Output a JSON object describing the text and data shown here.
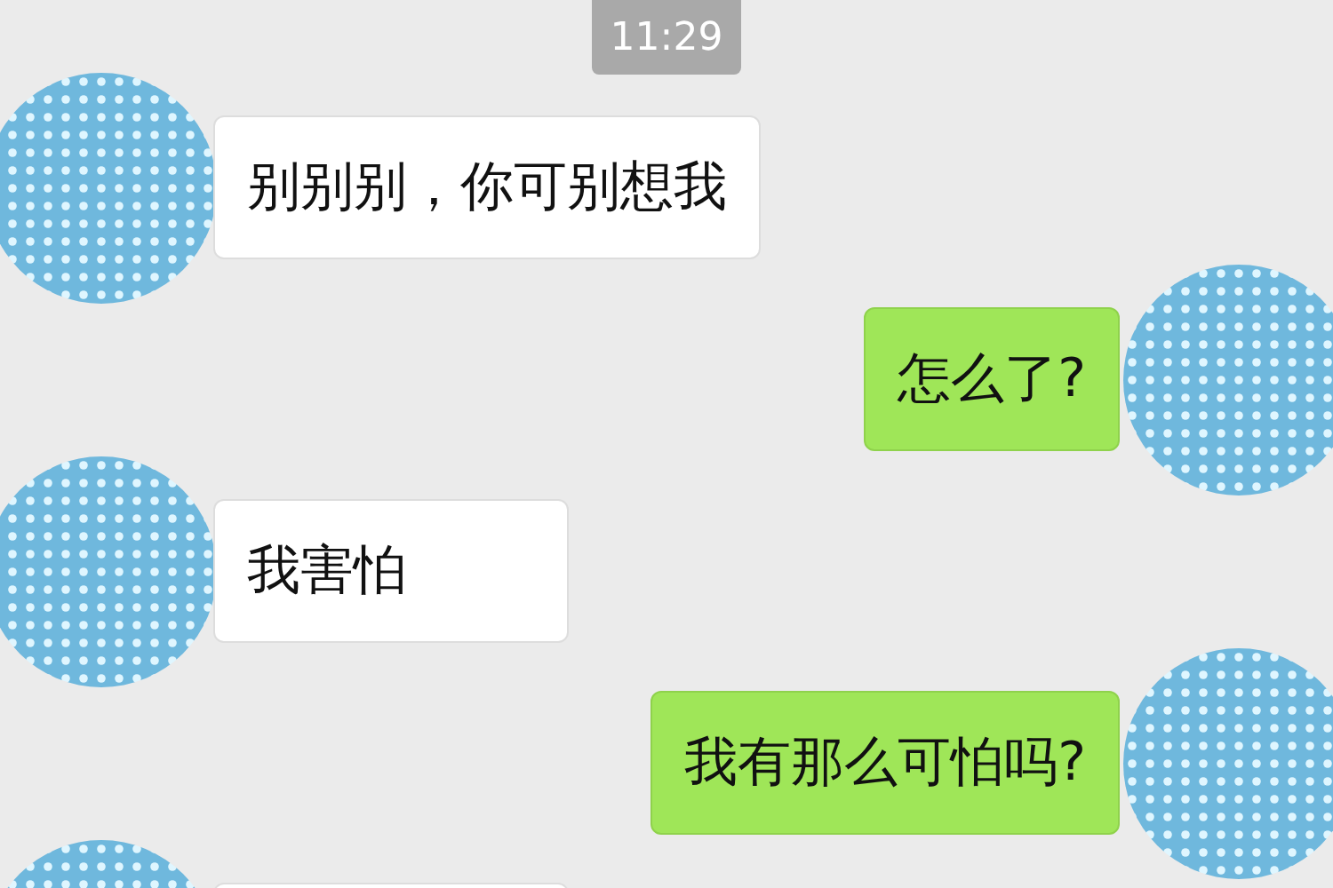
{
  "time": "11:29",
  "messages": [
    {
      "kind": "received",
      "text": "别别别，你可别想我"
    },
    {
      "kind": "sent",
      "text": "怎么了?"
    },
    {
      "kind": "received",
      "text": "我害怕"
    },
    {
      "kind": "sent",
      "text": "我有那么可怕吗?"
    },
    {
      "kind": "received"
    }
  ]
}
